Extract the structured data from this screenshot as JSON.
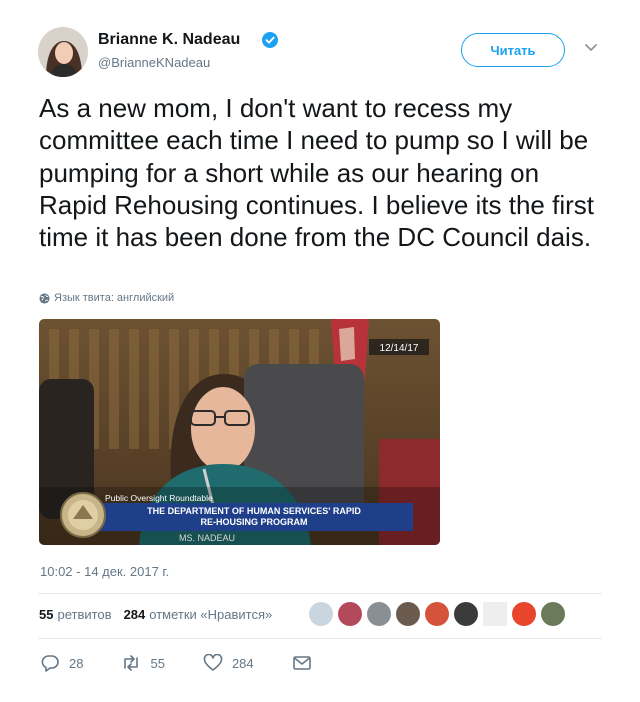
{
  "author": {
    "name": "Brianne K. Nadeau",
    "handle": "@BrianneKNadeau",
    "avatar_icon": "user-avatar-photo",
    "verified": true
  },
  "follow_label": "Читать",
  "tweet_text": "As a new mom, I don't want to recess my committee each time I need to pump so I will be pumping for a short while as our hearing on Rapid Rehousing continues. I believe its the first time it has been done from the DC Council dais.",
  "language_note": "Язык твита: английский",
  "media": {
    "date_stamp": "12/14/17",
    "lower_third_top": "Public Oversight Roundtable",
    "lower_third_line1": "THE DEPARTMENT OF HUMAN SERVICES' RAPID",
    "lower_third_line2": "RE-HOUSING PROGRAM",
    "nameplate": "MS. NADEAU"
  },
  "timestamp": "10:02 - 14 дек. 2017 г.",
  "stats": {
    "retweets_count": "55",
    "retweets_label": "ретвитов",
    "likes_count": "284",
    "likes_label": "отметки «Нравится»"
  },
  "likers": [
    {
      "icon": "avatar-1",
      "color": "#c9d6df"
    },
    {
      "icon": "avatar-2",
      "color": "#b34a5b"
    },
    {
      "icon": "avatar-3",
      "color": "#8a8f94"
    },
    {
      "icon": "avatar-4",
      "color": "#6b5a4e"
    },
    {
      "icon": "avatar-5",
      "color": "#d4533a"
    },
    {
      "icon": "avatar-6",
      "color": "#3b3b3b"
    },
    {
      "icon": "avatar-7",
      "color": "#eeeeee"
    },
    {
      "icon": "avatar-8",
      "color": "#e8452c"
    },
    {
      "icon": "avatar-9",
      "color": "#6b7a5a"
    }
  ],
  "actions": {
    "reply_count": "28",
    "retweet_count": "55",
    "like_count": "284"
  },
  "colors": {
    "accent": "#1da1f2",
    "secondary_text": "#657786",
    "lower_third_blue": "#1f3f8a"
  }
}
